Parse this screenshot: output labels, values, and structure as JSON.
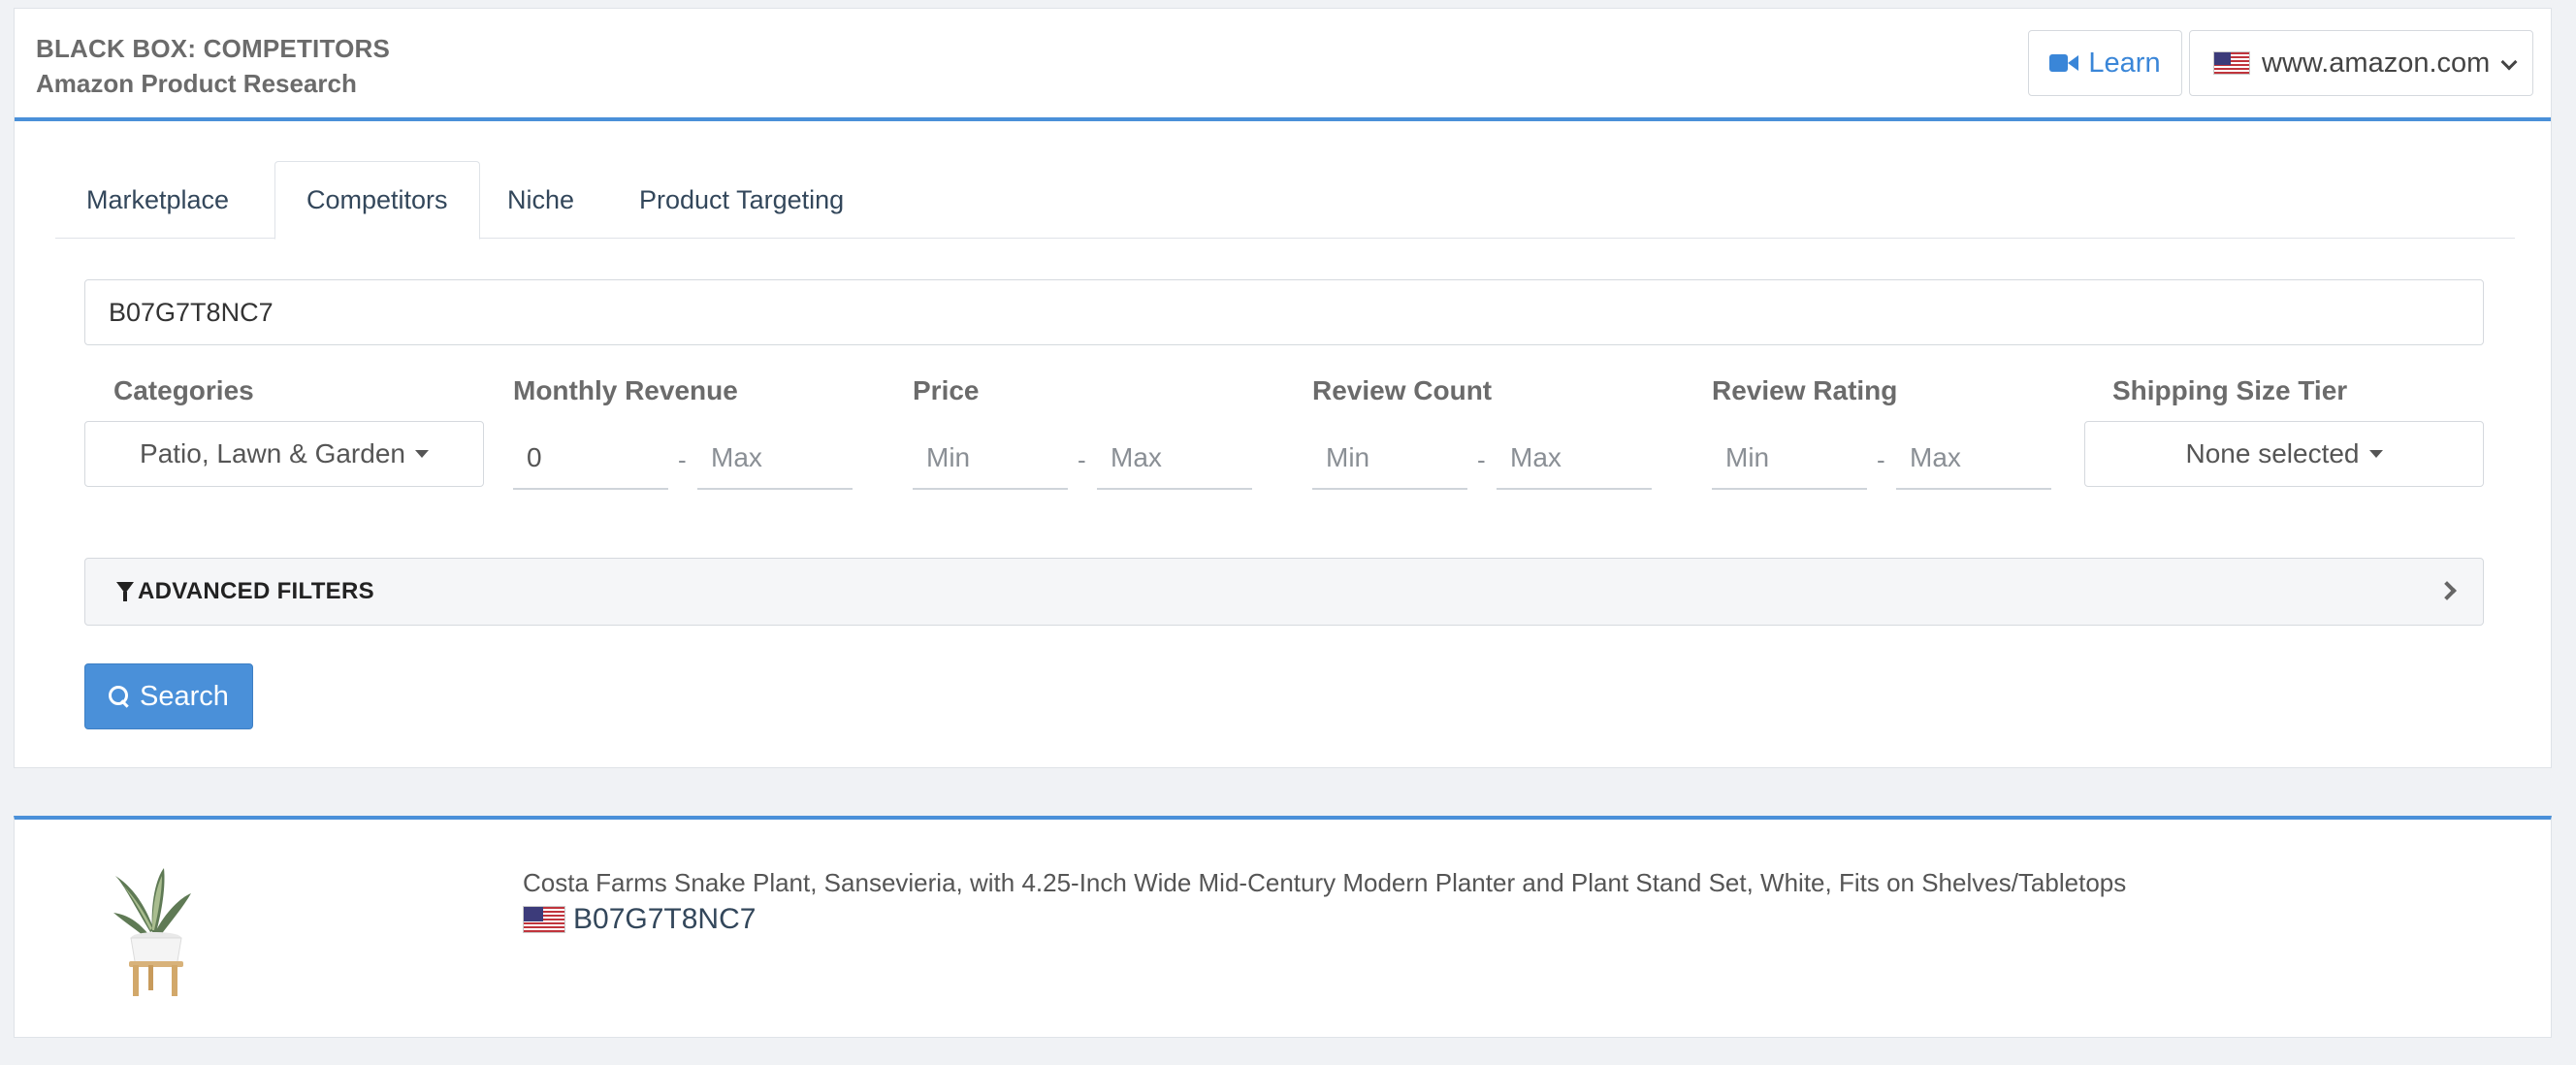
{
  "header": {
    "title": "BLACK BOX: COMPETITORS",
    "subtitle": "Amazon Product Research",
    "learn_label": "Learn",
    "marketplace": "www.amazon.com"
  },
  "tabs": [
    {
      "label": "Marketplace",
      "active": false
    },
    {
      "label": "Competitors",
      "active": true
    },
    {
      "label": "Niche",
      "active": false
    },
    {
      "label": "Product Targeting",
      "active": false
    }
  ],
  "search": {
    "asin_value": "B07G7T8NC7"
  },
  "filters": {
    "categories": {
      "label": "Categories",
      "selected": "Patio, Lawn & Garden"
    },
    "monthly_revenue": {
      "label": "Monthly Revenue",
      "min_value": "0",
      "max_placeholder": "Max"
    },
    "price": {
      "label": "Price",
      "min_placeholder": "Min",
      "max_placeholder": "Max"
    },
    "review_count": {
      "label": "Review Count",
      "min_placeholder": "Min",
      "max_placeholder": "Max"
    },
    "review_rating": {
      "label": "Review Rating",
      "min_placeholder": "Min",
      "max_placeholder": "Max"
    },
    "shipping_size_tier": {
      "label": "Shipping Size Tier",
      "selected": "None selected"
    },
    "range_separator": "-"
  },
  "advanced_filters_label": "ADVANCED FILTERS",
  "search_button_label": "Search",
  "result": {
    "title": "Costa Farms Snake Plant, Sansevieria, with 4.25-Inch Wide Mid-Century Modern Planter and Plant Stand Set, White, Fits on Shelves/Tabletops",
    "asin": "B07G7T8NC7"
  },
  "colors": {
    "accent": "#4a90d9",
    "link": "#3a86d8"
  }
}
